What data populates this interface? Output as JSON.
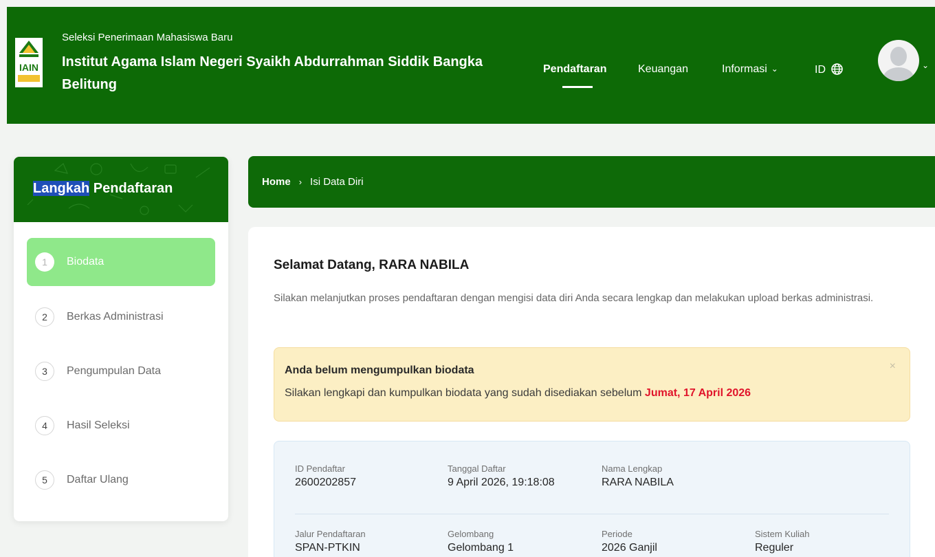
{
  "header": {
    "subtitle": "Seleksi Penerimaan Mahasiswa Baru",
    "title": "Institut Agama Islam Negeri Syaikh Abdurrahman Siddik Bangka Belitung",
    "logo_text": "IAIN",
    "nav": {
      "pendaftaran": "Pendaftaran",
      "keuangan": "Keuangan",
      "informasi": "Informasi",
      "lang": "ID"
    }
  },
  "sidebar": {
    "title_highlight": "Langkah",
    "title_rest": " Pendaftaran",
    "steps": [
      {
        "num": "1",
        "label": "Biodata"
      },
      {
        "num": "2",
        "label": "Berkas Administrasi"
      },
      {
        "num": "3",
        "label": "Pengumpulan Data"
      },
      {
        "num": "4",
        "label": "Hasil Seleksi"
      },
      {
        "num": "5",
        "label": "Daftar Ulang"
      }
    ]
  },
  "breadcrumb": {
    "home": "Home",
    "current": "Isi Data Diri"
  },
  "main": {
    "welcome": "Selamat Datang, RARA NABILA",
    "intro": "Silakan melanjutkan proses pendaftaran dengan mengisi data diri Anda secara lengkap dan melakukan upload berkas administrasi.",
    "alert": {
      "title": "Anda belum mengumpulkan biodata",
      "text": "Silakan lengkapi dan kumpulkan biodata yang sudah disediakan sebelum ",
      "date": "Jumat, 17 April 2026",
      "close": "×"
    },
    "info": {
      "id_label": "ID Pendaftar",
      "id_value": "2600202857",
      "tanggal_label": "Tanggal Daftar",
      "tanggal_value": "9 April 2026, 19:18:08",
      "nama_label": "Nama Lengkap",
      "nama_value": "RARA NABILA",
      "jalur_label": "Jalur Pendaftaran",
      "jalur_value": "SPAN-PTKIN",
      "gelombang_label": "Gelombang",
      "gelombang_value": "Gelombang 1",
      "periode_label": "Periode",
      "periode_value": "2026 Ganjil",
      "sistem_label": "Sistem Kuliah",
      "sistem_value": "Reguler"
    }
  },
  "colors": {
    "primary": "#0d6a06",
    "active_step": "#8fe88a",
    "alert_bg": "#fcefc4",
    "deadline": "#e0142b"
  }
}
